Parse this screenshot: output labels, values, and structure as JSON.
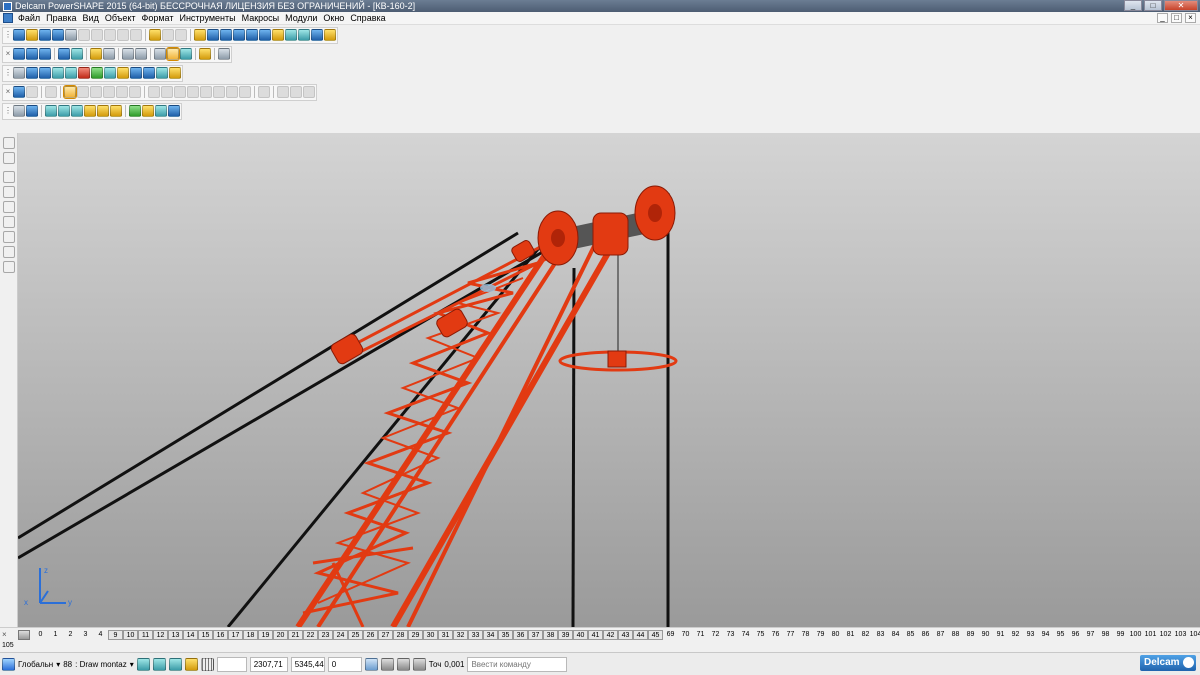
{
  "window": {
    "title": "Delcam PowerSHAPE 2015 (64-bit) БЕССРОЧНАЯ ЛИЦЕНЗИЯ БЕЗ ОГРАНИЧЕНИЙ - [КВ-160-2]",
    "minimize": "_",
    "maximize": "□",
    "close": "✕"
  },
  "menu": {
    "items": [
      "Файл",
      "Правка",
      "Вид",
      "Объект",
      "Формат",
      "Инструменты",
      "Макросы",
      "Модули",
      "Окно",
      "Справка"
    ],
    "mdi_minimize": "_",
    "mdi_restore": "□",
    "mdi_close": "×"
  },
  "toolbar_close": "×",
  "levels": {
    "items": [
      "0",
      "1",
      "2",
      "3",
      "4",
      "9",
      "10",
      "11",
      "12",
      "13",
      "14",
      "15",
      "16",
      "17",
      "18",
      "19",
      "20",
      "21",
      "22",
      "23",
      "24",
      "25",
      "26",
      "27",
      "28",
      "29",
      "30",
      "31",
      "32",
      "33",
      "34",
      "35",
      "36",
      "37",
      "38",
      "39",
      "40",
      "41",
      "42",
      "43",
      "44",
      "45",
      "69",
      "70",
      "71",
      "72",
      "73",
      "74",
      "75",
      "76",
      "77",
      "78",
      "79",
      "80",
      "81",
      "82",
      "83",
      "84",
      "85",
      "86",
      "87",
      "88",
      "89",
      "90",
      "91",
      "92",
      "93",
      "94",
      "95",
      "96",
      "97",
      "98",
      "99",
      "100",
      "101",
      "102",
      "103",
      "104"
    ],
    "extra": "105"
  },
  "status": {
    "workplane": "Глобальн",
    "workplane_arrow": "▾",
    "level_num": "88",
    "level_name": ": Draw montaz",
    "level_arrow": "▾",
    "coord_x": "2307,71",
    "coord_y": "5345,44",
    "coord_z": "0",
    "tolerance_label": "Точ",
    "tolerance_value": "0,001",
    "command_placeholder": "Ввести команду"
  },
  "brand": {
    "logo_text": "Delcam"
  },
  "triad": {
    "x": "x",
    "y": "y",
    "z": "z"
  }
}
